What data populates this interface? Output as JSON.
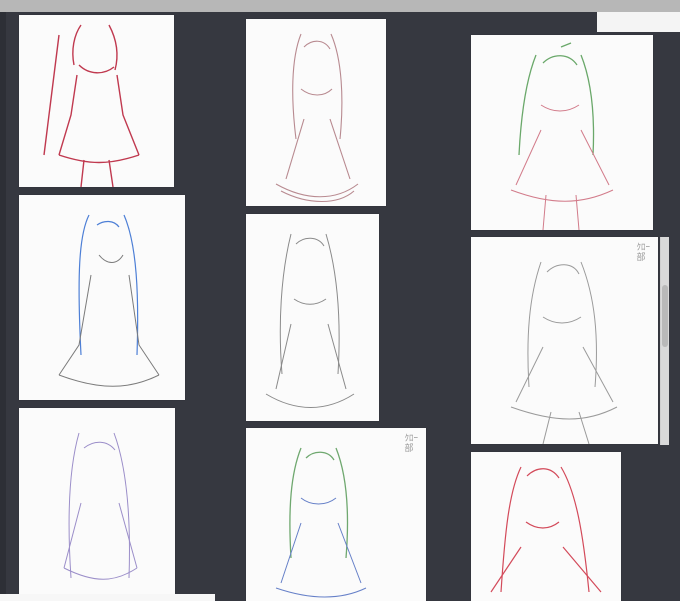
{
  "canvas": {
    "background": "#363840"
  },
  "gallery": {
    "thumbnails": [
      {
        "id": "sketch-1",
        "stroke": "#c0394f",
        "label": ""
      },
      {
        "id": "sketch-2",
        "stroke": "#b88a90",
        "label": ""
      },
      {
        "id": "sketch-3",
        "stroke": "#6aa86a",
        "label": ""
      },
      {
        "id": "sketch-4",
        "stroke": "#4d7fd6",
        "label": ""
      },
      {
        "id": "sketch-5",
        "stroke": "#8a8a8a",
        "label": ""
      },
      {
        "id": "sketch-6",
        "stroke": "#9a9a9a",
        "label": "ｸﾛｰ\n部"
      },
      {
        "id": "sketch-7",
        "stroke": "#9b8ec9",
        "label": ""
      },
      {
        "id": "sketch-8",
        "stroke": "#6fa86f",
        "label": "ｸﾛｰ\n部"
      },
      {
        "id": "sketch-9",
        "stroke": "#d34a5a",
        "label": ""
      }
    ]
  },
  "scrollbar": {
    "position_fraction": 0.3
  }
}
